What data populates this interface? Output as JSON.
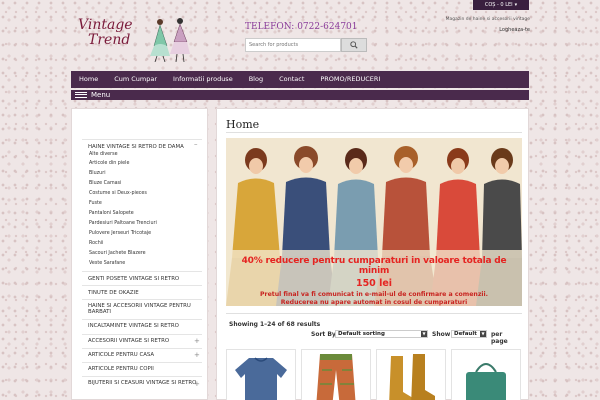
{
  "header": {
    "logo_line1": "Vintage",
    "logo_line2": "Trend",
    "phone": "TELEFON: 0722-624701",
    "search_placeholder": "Search for products",
    "cart_label": "COȘ - 0 LEI",
    "tagline": "Magazin de haine si accesorii vintage",
    "login_label": "Logheaza-te"
  },
  "nav": {
    "items": [
      "Home",
      "Cum Cumpar",
      "Informatii produse",
      "Blog",
      "Contact",
      "PROMO/REDUCERI"
    ],
    "menu_label": "Menu"
  },
  "sidebar": {
    "main_category": "HAINE VINTAGE SI RETRO DE DAMA",
    "subcategories": [
      "Alte diverse",
      "Articole din piele",
      "Bluzuri",
      "Bluze Camasi",
      "Costume si Deux-pieces",
      "Fuste",
      "Pantaloni Salopete",
      "Pardesiuri Paltoane Trenciuri",
      "Pulovere Jerseuri Tricotaje",
      "Rochii",
      "Sacouri Jachete Blazere",
      "Veste Sarafane"
    ],
    "categories": [
      "GENTI POSETE VINTAGE SI RETRO",
      "TINUTE DE OKAZIE",
      "HAINE SI ACCESORII VINTAGE PENTRU BARBATI",
      "INCALTAMINTE VINTAGE SI RETRO",
      "ACCESORII VINTAGE SI RETRO",
      "ARTICOLE PENTRU CASA",
      "ARTICOLE PENTRU COPII",
      "BIJUTERII SI CEASURI VINTAGE SI RETRO"
    ]
  },
  "main": {
    "title": "Home",
    "promo_line1": "40% reducere pentru cumparaturi in valoare totala de minim",
    "promo_line2": "150 lei",
    "promo_line3": "Pretul final va fi comunicat in e-mail-ul de confirmare a comenzii.",
    "promo_line4": "Reducerea nu apare automat in cosul de cumparaturi",
    "results_text": "Showing 1–24 of 68 results",
    "sort_by_label": "Sort By",
    "sort_value": "Default sorting",
    "show_label": "Show",
    "show_value": "Default",
    "per_page_label": "per page"
  },
  "colors": {
    "nav_bg": "#4a2a4c",
    "logo": "#7a1a3a",
    "phone": "#8a3c9a",
    "promo_red": "#e52421"
  }
}
